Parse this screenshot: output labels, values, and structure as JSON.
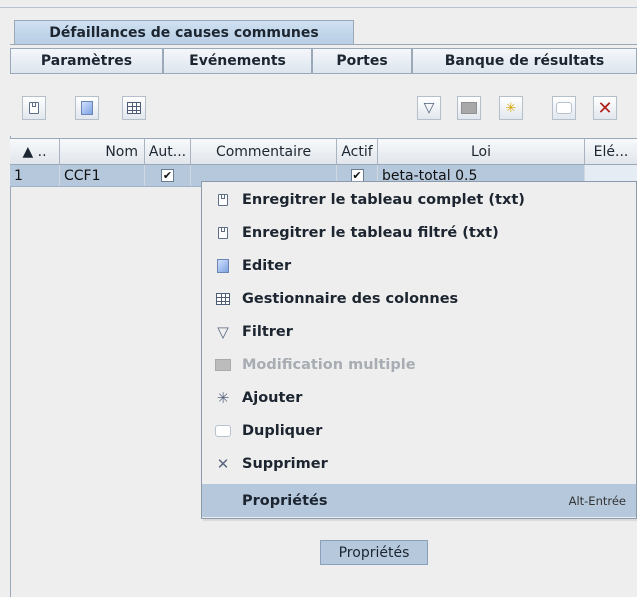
{
  "tabs": {
    "top": "Défaillances de causes communes",
    "row": [
      "Paramètres",
      "Evénements",
      "Portes",
      "Banque de résultats"
    ]
  },
  "toolbar": {
    "left_icons": [
      "save-icon",
      "edit-icon",
      "columns-icon"
    ],
    "right_icons": [
      "filter-icon",
      "multi-edit-icon",
      "add-icon",
      "duplicate-icon",
      "delete-icon"
    ]
  },
  "table": {
    "headers": [
      "▲ ..",
      "Nom",
      "Aut...",
      "Commentaire",
      "Actif",
      "Loi",
      "Elé..."
    ],
    "rows": [
      {
        "index": "1",
        "nom": "CCF1",
        "aut": "✔",
        "commentaire": "",
        "actif": "✔",
        "loi": "beta-total 0.5"
      }
    ]
  },
  "context_menu": {
    "items": [
      {
        "label": "Enregitrer le tableau complet (txt)",
        "icon": "save-icon",
        "disabled": false
      },
      {
        "label": "Enregitrer le tableau filtré (txt)",
        "icon": "save-icon",
        "disabled": false
      },
      {
        "label": "Editer",
        "icon": "edit-icon",
        "disabled": false
      },
      {
        "label": "Gestionnaire des colonnes",
        "icon": "columns-icon",
        "disabled": false
      },
      {
        "label": "Filtrer",
        "icon": "filter-icon",
        "disabled": false
      },
      {
        "label": "Modification multiple",
        "icon": "multi-edit-icon",
        "disabled": true
      },
      {
        "label": "Ajouter",
        "icon": "add-icon",
        "disabled": false
      },
      {
        "label": "Dupliquer",
        "icon": "duplicate-icon",
        "disabled": false
      },
      {
        "label": "Supprimer",
        "icon": "delete-icon",
        "disabled": false
      },
      {
        "label": "Propriétés",
        "icon": "",
        "disabled": false,
        "shortcut": "Alt-Entrée",
        "highlighted": true
      }
    ]
  },
  "bottom_button": {
    "label": "Propriétés"
  },
  "colors": {
    "selection": "#b6c8dc",
    "background": "#eeeeee",
    "delete": "#b0201a"
  }
}
